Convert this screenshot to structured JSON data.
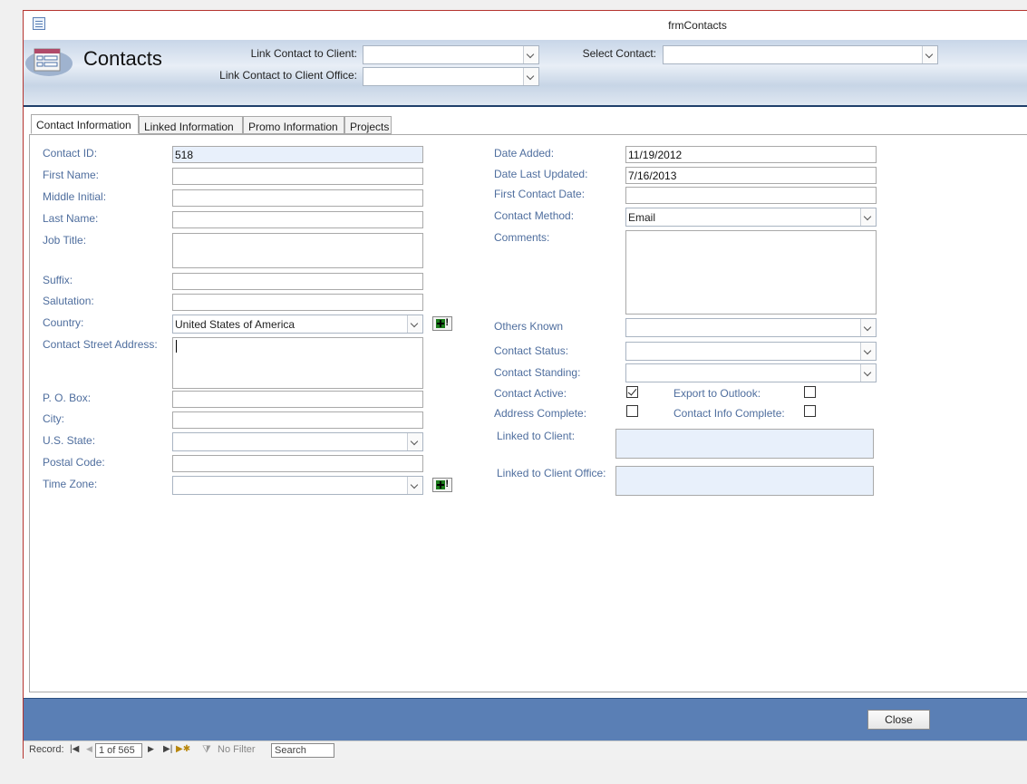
{
  "window": {
    "title": "frmContacts"
  },
  "header": {
    "title": "Contacts",
    "link_client_label": "Link Contact to Client:",
    "link_office_label": "Link Contact to Client Office:",
    "select_contact_label": "Select Contact:"
  },
  "tabs": [
    "Contact Information",
    "Linked Information",
    "Promo Information",
    "Projects"
  ],
  "left": {
    "contact_id": {
      "label": "Contact ID:",
      "value": "518"
    },
    "first_name": {
      "label": "First Name:",
      "value": ""
    },
    "middle_initial": {
      "label": "Middle Initial:",
      "value": ""
    },
    "last_name": {
      "label": "Last Name:",
      "value": ""
    },
    "job_title": {
      "label": "Job Title:",
      "value": ""
    },
    "suffix": {
      "label": "Suffix:",
      "value": ""
    },
    "salutation": {
      "label": "Salutation:",
      "value": ""
    },
    "country": {
      "label": "Country:",
      "value": "United States of America"
    },
    "street": {
      "label": "Contact Street Address:",
      "value": ""
    },
    "po_box": {
      "label": "P. O. Box:",
      "value": ""
    },
    "city": {
      "label": "City:",
      "value": ""
    },
    "state": {
      "label": "U.S. State:",
      "value": ""
    },
    "postal": {
      "label": "Postal Code:",
      "value": ""
    },
    "time_zone": {
      "label": "Time Zone:",
      "value": ""
    }
  },
  "right": {
    "date_added": {
      "label": "Date Added:",
      "value": "11/19/2012"
    },
    "date_updated": {
      "label": "Date Last Updated:",
      "value": "7/16/2013"
    },
    "first_contact": {
      "label": "First Contact Date:",
      "value": ""
    },
    "method": {
      "label": "Contact Method:",
      "value": "Email"
    },
    "comments": {
      "label": "Comments:",
      "value": ""
    },
    "others_known": {
      "label": "Others Known",
      "value": ""
    },
    "status": {
      "label": "Contact Status:",
      "value": ""
    },
    "standing": {
      "label": "Contact Standing:",
      "value": ""
    },
    "active": {
      "label": "Contact Active:",
      "checked": true
    },
    "export_outlook": {
      "label": "Export to Outlook:",
      "checked": false
    },
    "address_complete": {
      "label": "Address Complete:",
      "checked": false
    },
    "info_complete": {
      "label": "Contact Info Complete:",
      "checked": false
    },
    "linked_client": {
      "label": "Linked to Client:"
    },
    "linked_office": {
      "label": "Linked to Client Office:"
    }
  },
  "footer": {
    "close_label": "Close"
  },
  "navbar": {
    "record_label": "Record:",
    "position": "1 of 565",
    "filter_label": "No Filter",
    "search_label": "Search"
  },
  "colors": {
    "accent": "#5a7fb5",
    "label": "#4f6e9e",
    "border": "#b4342f"
  }
}
